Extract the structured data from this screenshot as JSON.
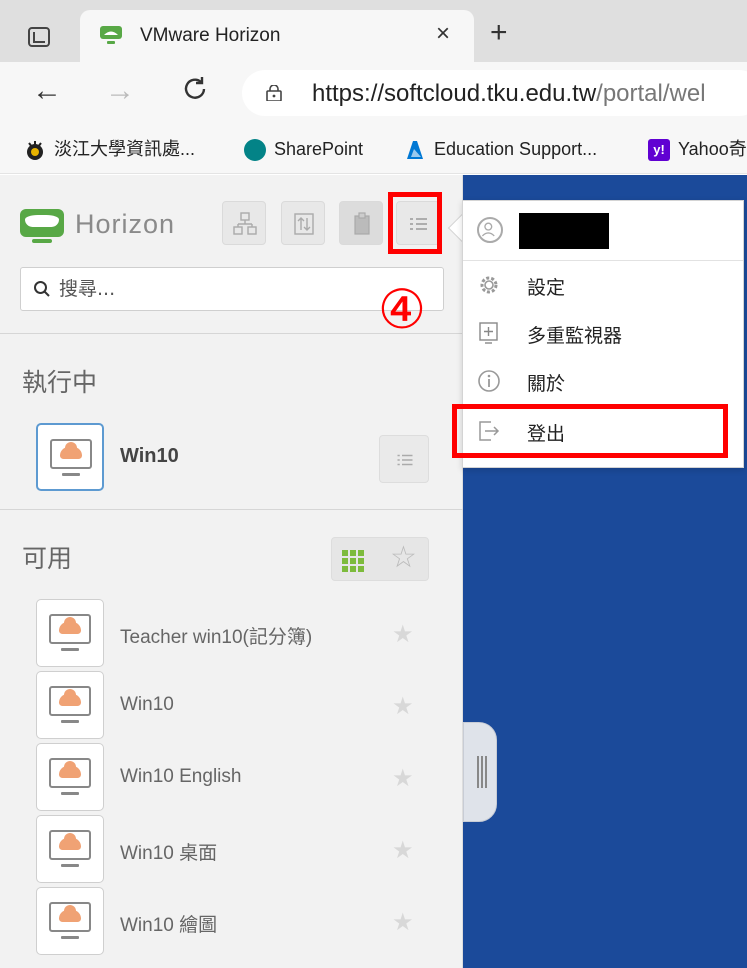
{
  "browser": {
    "tab_title": "VMware Horizon",
    "tab_close": "×",
    "new_tab": "+",
    "back": "←",
    "forward": "→",
    "reload": "C",
    "url_host": "https://softcloud.tku.edu.tw",
    "url_path": "/portal/wel",
    "bookmarks": [
      {
        "label": "淡江大學資訊處...",
        "icon": "tku-icon",
        "color": "#222222"
      },
      {
        "label": "SharePoint",
        "icon": "sharepoint-icon",
        "color": "#038387"
      },
      {
        "label": "Education Support...",
        "icon": "azure-icon",
        "color": "#0078d4"
      },
      {
        "label": "Yahoo奇",
        "icon": "yahoo-icon",
        "color": "#6001d2"
      }
    ]
  },
  "app": {
    "logo_text": "Horizon",
    "search_placeholder": "搜尋...",
    "running_title": "執行中",
    "running_items": [
      {
        "label": "Win10"
      }
    ],
    "available_title": "可用",
    "available_items": [
      {
        "label": "Teacher win10(記分簿)"
      },
      {
        "label": "Win10"
      },
      {
        "label": "Win10 English"
      },
      {
        "label": "Win10 桌面"
      },
      {
        "label": "Win10 繪圖"
      }
    ],
    "star": "★",
    "fav_star": "☆",
    "accent_green": "#58a846",
    "right_bg": "#1b4a9a"
  },
  "menu": {
    "items": [
      {
        "label": "設定",
        "icon": "gear-icon"
      },
      {
        "label": "多重監視器",
        "icon": "multi-monitor-icon"
      },
      {
        "label": "關於",
        "icon": "info-icon"
      },
      {
        "label": "登出",
        "icon": "logout-icon"
      }
    ]
  },
  "annotation": {
    "step": "④",
    "color": "#ff0000"
  }
}
